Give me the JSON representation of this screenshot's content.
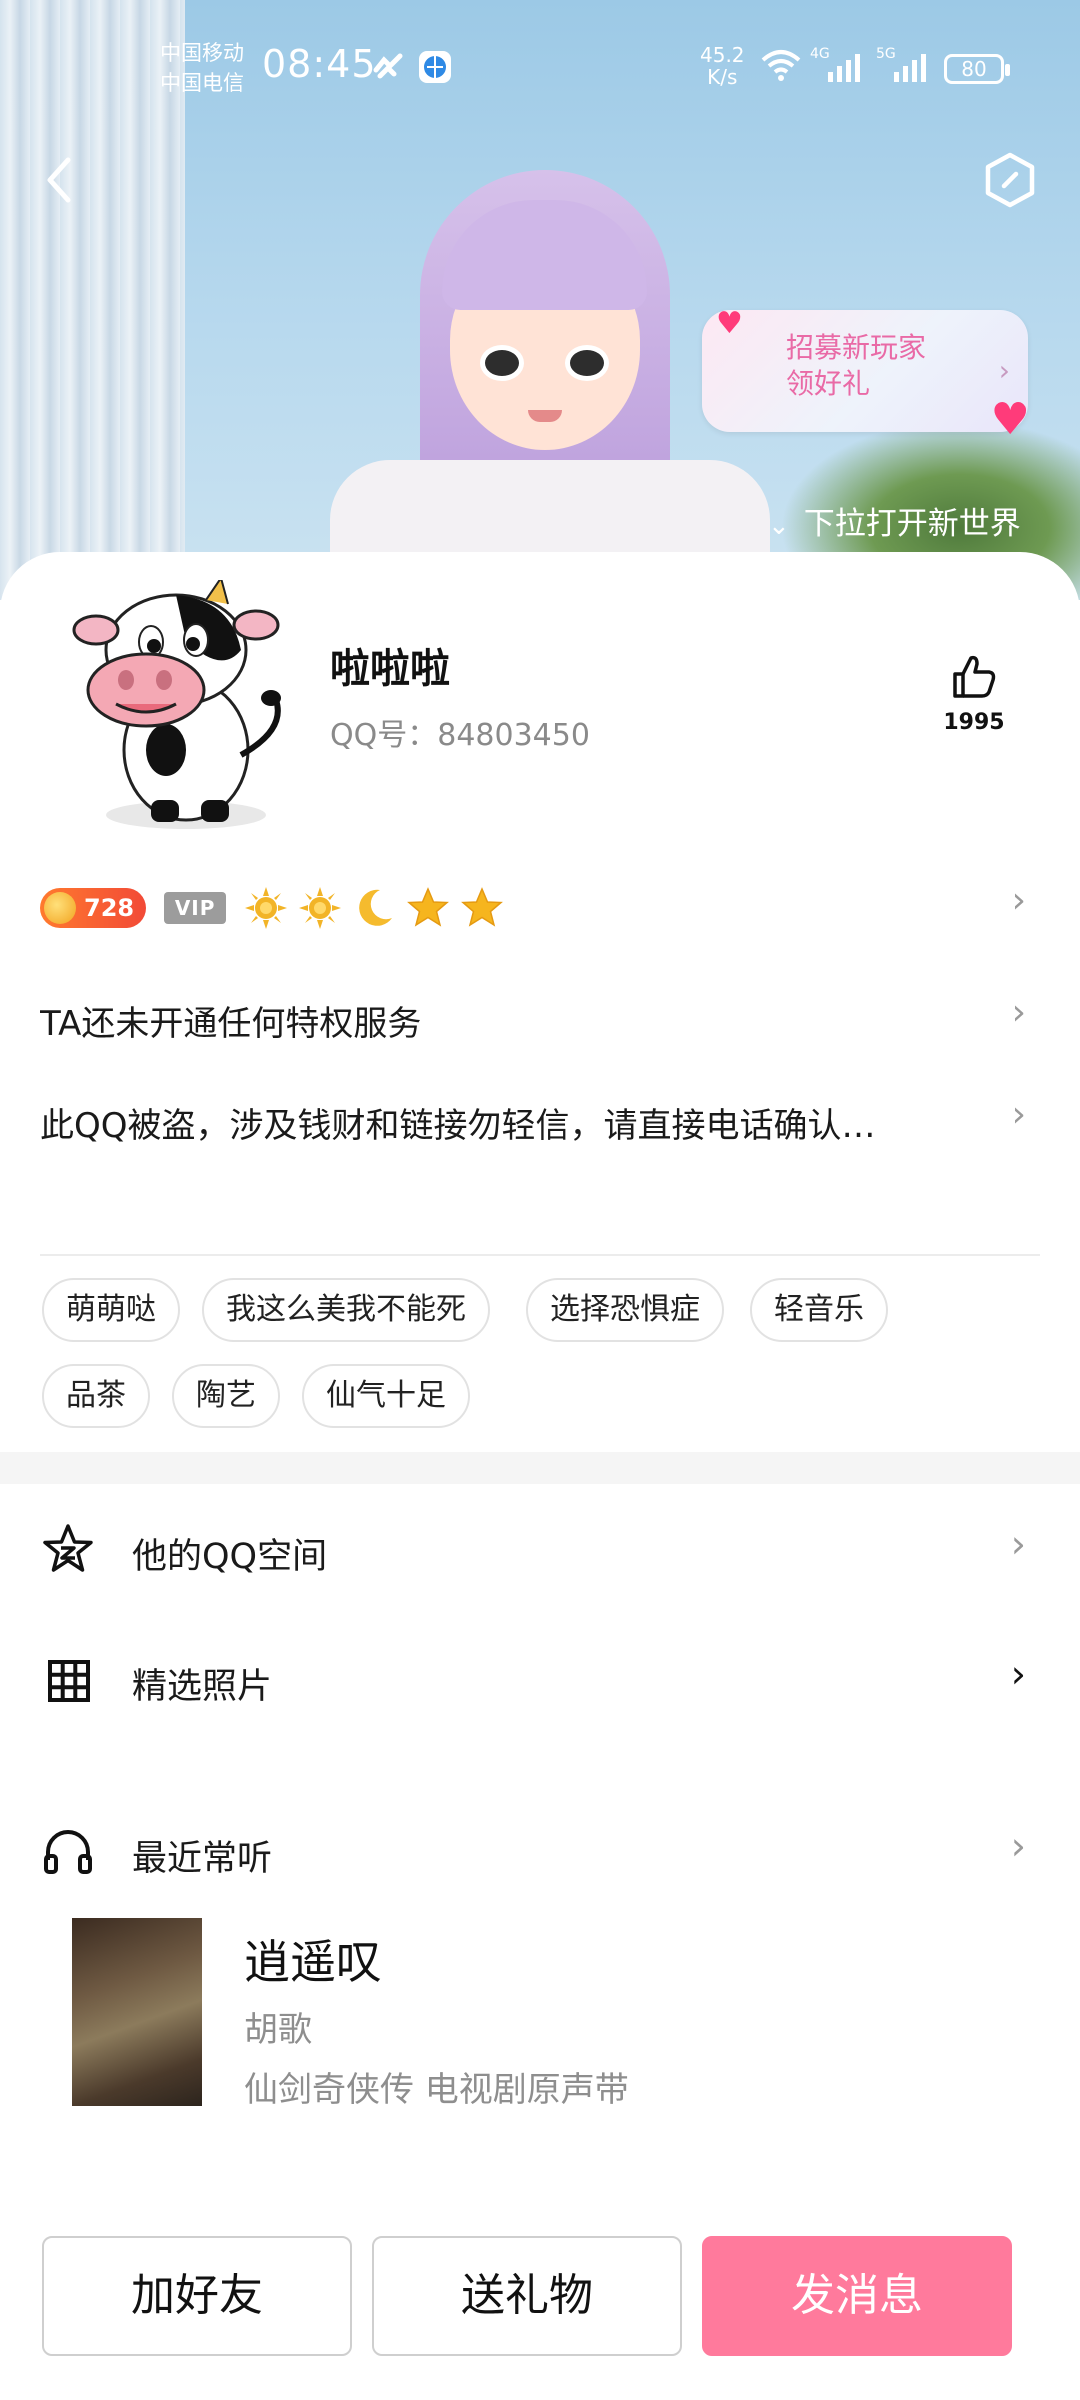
{
  "status_bar": {
    "carrier_1": "中国移动",
    "carrier_2": "中国电信",
    "time": "08:45",
    "net_speed_value": "45.2",
    "net_speed_unit": "K/s",
    "net_1": "4G",
    "net_2": "5G",
    "battery": "80"
  },
  "banner": {
    "promo_line_1": "招募新玩家",
    "promo_line_2": "领好礼",
    "pull_down_text": "下拉打开新世界"
  },
  "profile": {
    "nickname": "啦啦啦",
    "qq_number": "QQ号：84803450",
    "like_count": "1995",
    "level_number": "728",
    "vip_label": "VIP",
    "level_icons": [
      "sun-icon",
      "sun-icon",
      "moon-icon",
      "star-icon",
      "star-icon"
    ],
    "privilege_text": "TA还未开通任何特权服务",
    "signature": "此QQ被盗，涉及钱财和链接勿轻信，请直接电话确认…"
  },
  "tags": [
    "萌萌哒",
    "我这么美我不能死",
    "选择恐惧症",
    "轻音乐",
    "品茶",
    "陶艺",
    "仙气十足"
  ],
  "menu": {
    "qzone": "他的QQ空间",
    "photos": "精选照片",
    "music": "最近常听"
  },
  "music": {
    "title": "逍遥叹",
    "artist": "胡歌",
    "album": "仙剑奇侠传 电视剧原声带"
  },
  "actions": {
    "add_friend": "加好友",
    "send_gift": "送礼物",
    "send_message": "发消息"
  },
  "colors": {
    "primary_button": "#ff7a9c",
    "promo_text": "#e96aa6",
    "level_badge": "#f24a37"
  }
}
